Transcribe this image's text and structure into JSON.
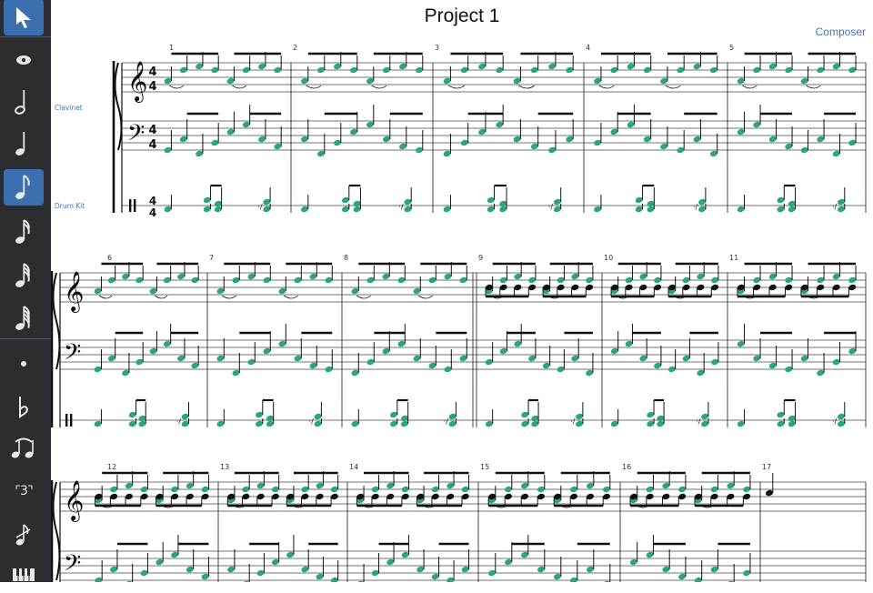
{
  "score": {
    "title": "Project 1",
    "composer": "Composer",
    "time_signature": [
      "4",
      "4"
    ],
    "instruments": [
      "Clavinet",
      "Drum Kit"
    ],
    "measure_numbers": [
      "1",
      "2",
      "3",
      "4",
      "5",
      "6",
      "7",
      "8",
      "9",
      "10",
      "11",
      "12",
      "13",
      "14",
      "15",
      "16",
      "17"
    ]
  },
  "toolbar": {
    "tools": [
      {
        "name": "select-tool",
        "icon": "arrow-cursor-icon",
        "active": true
      },
      {
        "name": "view-tool",
        "icon": "eye-icon",
        "active": false
      },
      {
        "name": "half-note-tool",
        "icon": "half-note-icon",
        "active": false
      },
      {
        "name": "quarter-note-tool",
        "icon": "quarter-note-icon",
        "active": false
      },
      {
        "name": "eighth-note-tool",
        "icon": "eighth-note-icon",
        "active": true
      },
      {
        "name": "sixteenth-note-tool",
        "icon": "sixteenth-note-icon",
        "active": false
      },
      {
        "name": "thirty-second-note-tool",
        "icon": "thirty-second-note-icon",
        "active": false
      },
      {
        "name": "sixty-fourth-note-tool",
        "icon": "sixty-fourth-note-icon",
        "active": false
      },
      {
        "name": "dot-tool",
        "icon": "dot-icon",
        "active": false
      },
      {
        "name": "flat-tool",
        "icon": "flat-icon",
        "active": false
      },
      {
        "name": "tie-tool",
        "icon": "tie-icon",
        "active": false
      },
      {
        "name": "triplet-tool",
        "icon": "triplet-icon",
        "active": false,
        "label": "3"
      },
      {
        "name": "grace-note-tool",
        "icon": "grace-note-icon",
        "active": false
      },
      {
        "name": "piano-tool",
        "icon": "piano-keys-icon",
        "active": false
      }
    ]
  },
  "colors": {
    "note_accent": "#2aa57e",
    "toolbar_bg": "#2c2d30",
    "active_tool": "#3b6fb0",
    "link_text": "#3f78b5"
  }
}
